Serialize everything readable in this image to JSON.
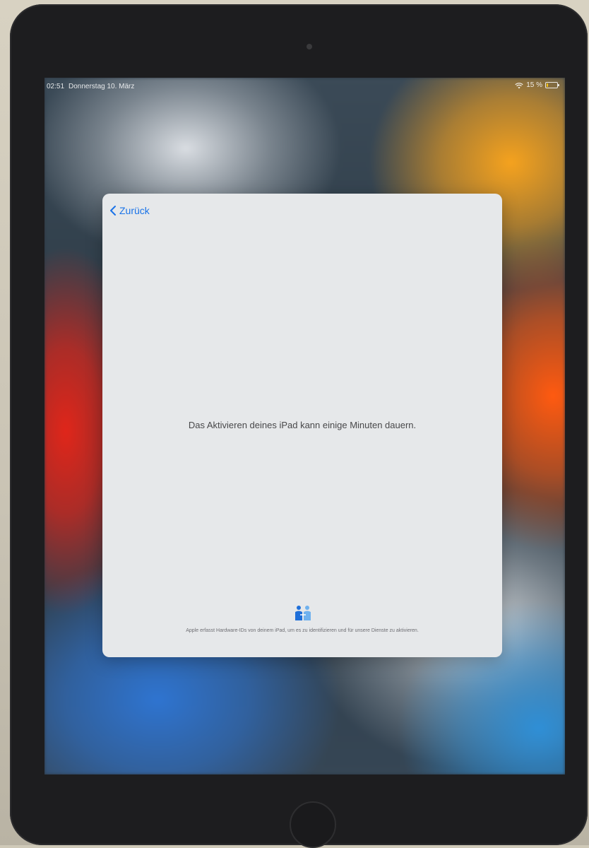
{
  "status_bar": {
    "time": "02:51",
    "date": "Donnerstag 10. März",
    "battery_text": "15 %",
    "battery_level": 0.15
  },
  "setup_sheet": {
    "back_label": "Zurück",
    "message": "Das Aktivieren deines iPad kann einige Minuten dauern.",
    "privacy_text": "Apple erfasst Hardware-IDs von deinem iPad, um es zu identifizieren und für unsere Dienste zu aktivieren.",
    "accent_color": "#1a73e8",
    "privacy_icon": "handshake-people-icon"
  }
}
